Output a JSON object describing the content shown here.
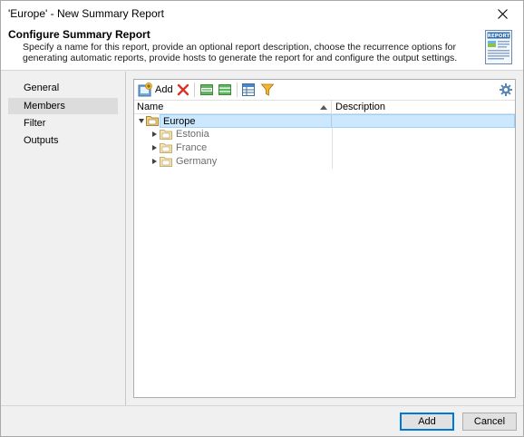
{
  "window": {
    "title": "'Europe' - New Summary Report"
  },
  "header": {
    "title": "Configure Summary Report",
    "description": "Specify a name for this report, provide an optional report description, choose the recurrence options for generating automatic reports, provide hosts to generate the report for and configure the output settings.",
    "icon": "report-icon",
    "icon_label": "REPORT"
  },
  "sidebar": {
    "items": [
      {
        "label": "General",
        "active": false
      },
      {
        "label": "Members",
        "active": true
      },
      {
        "label": "Filter",
        "active": false
      },
      {
        "label": "Outputs",
        "active": false
      }
    ]
  },
  "toolbar": {
    "add_label": "Add",
    "icons": [
      "add-icon",
      "delete-icon",
      "expand-all-icon",
      "collapse-all-icon",
      "columns-icon",
      "filter-icon",
      "settings-icon"
    ]
  },
  "grid": {
    "columns": [
      "Name",
      "Description"
    ],
    "sort": {
      "column": "Name",
      "direction": "ascending"
    },
    "rows": [
      {
        "name": "Europe",
        "description": "",
        "expanded": true,
        "selected": true,
        "enabled": true
      },
      {
        "name": "Estonia",
        "description": "",
        "expanded": false,
        "selected": false,
        "enabled": false
      },
      {
        "name": "France",
        "description": "",
        "expanded": false,
        "selected": false,
        "enabled": false
      },
      {
        "name": "Germany",
        "description": "",
        "expanded": false,
        "selected": false,
        "enabled": false
      }
    ]
  },
  "footer": {
    "add_label": "Add",
    "cancel_label": "Cancel"
  },
  "colors": {
    "selection": "#cce8ff",
    "selection_border": "#99d1ff",
    "default_button_border": "#0078d7",
    "folder": "#e8c56b"
  }
}
